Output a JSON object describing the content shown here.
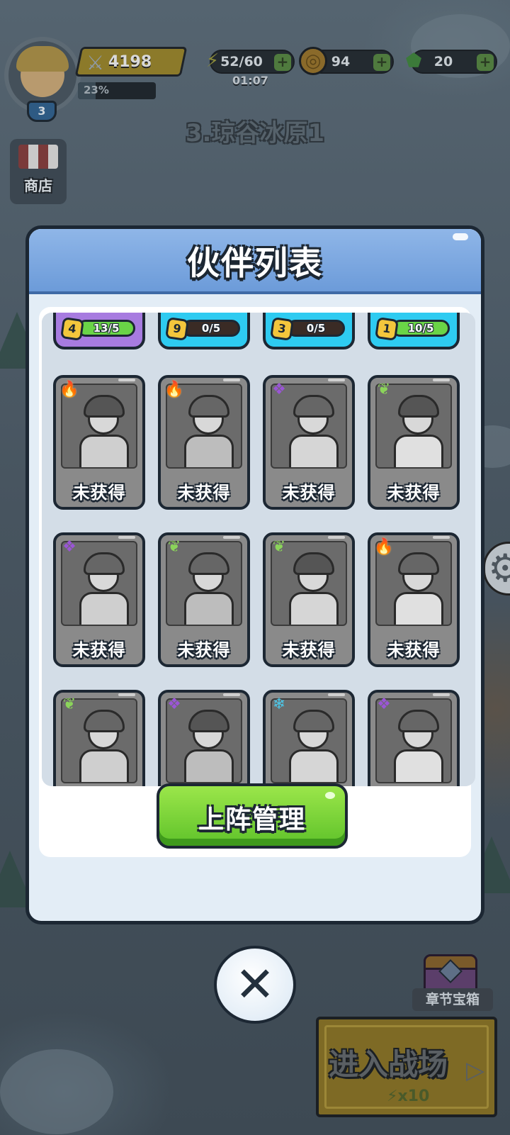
{
  "hud": {
    "player_level": "3",
    "power": "4198",
    "exp_percent": "23%",
    "exp_fraction": 0.23,
    "energy": "52/60",
    "energy_timer": "01:07",
    "coins": "94",
    "gems": "20",
    "plus": "+"
  },
  "stage": {
    "title": "3.琼谷冰原1"
  },
  "sidebar": {
    "shop_label": "商店"
  },
  "right_side": {
    "chapter_chest_label": "章节宝箱",
    "battle_label": "进入战场",
    "battle_cost": "x10"
  },
  "panel": {
    "title": "伙伴列表",
    "deploy_button": "上阵管理",
    "close": "✕"
  },
  "fragment_cards": [
    {
      "level": "4",
      "progress": "13/5",
      "fill": 1.0,
      "color": "#a77be0"
    },
    {
      "level": "9",
      "progress": "0/5",
      "fill": 0.0,
      "color": "#2ecbf1"
    },
    {
      "level": "3",
      "progress": "0/5",
      "fill": 0.0,
      "color": "#2ecbf1"
    },
    {
      "level": "1",
      "progress": "10/5",
      "fill": 1.0,
      "color": "#2ecbf1"
    }
  ],
  "partners": [
    {
      "status": "未获得",
      "element": "fire-icon"
    },
    {
      "status": "未获得",
      "element": "fire-icon"
    },
    {
      "status": "未获得",
      "element": "dark-icon"
    },
    {
      "status": "未获得",
      "element": "wind-icon"
    },
    {
      "status": "未获得",
      "element": "dark-icon"
    },
    {
      "status": "未获得",
      "element": "wind-icon"
    },
    {
      "status": "未获得",
      "element": "wind-icon"
    },
    {
      "status": "未获得",
      "element": "fire-icon"
    },
    {
      "status": "",
      "element": "wind-icon"
    },
    {
      "status": "",
      "element": "dark-icon"
    },
    {
      "status": "",
      "element": "ice-icon"
    },
    {
      "status": "",
      "element": "dark-icon"
    }
  ]
}
